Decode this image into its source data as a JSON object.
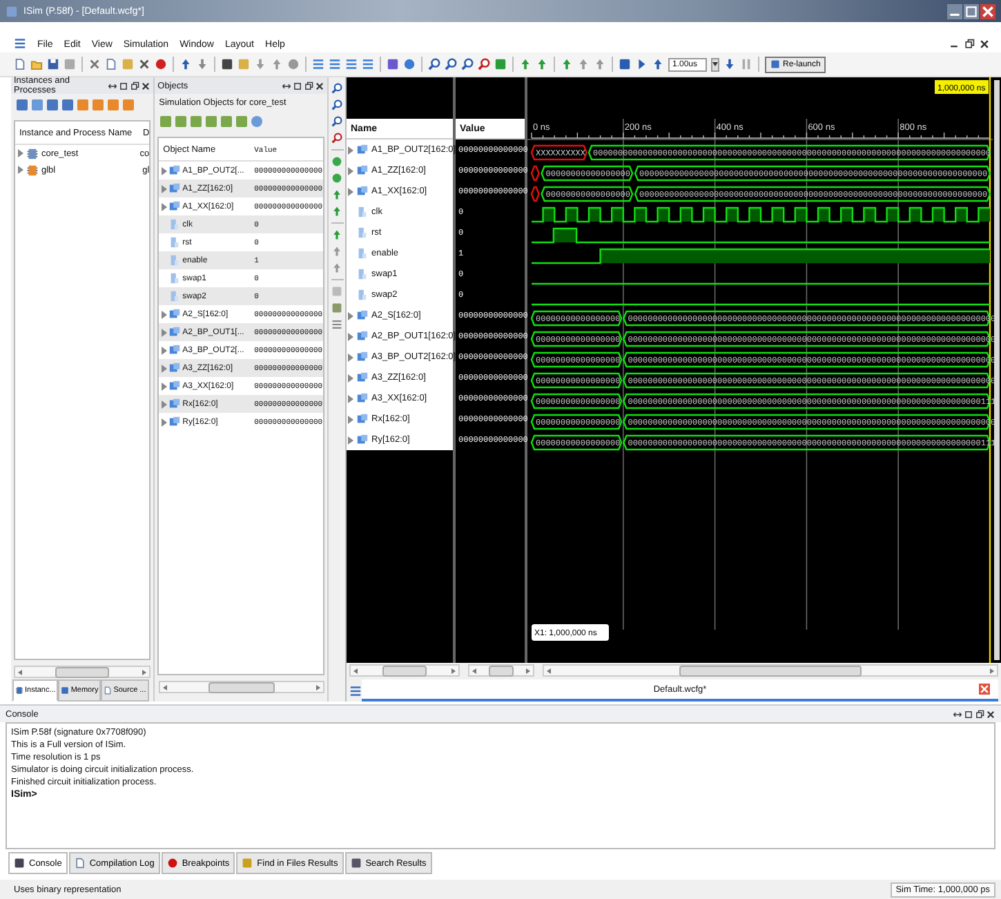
{
  "window": {
    "title": "ISim (P.58f) - [Default.wcfg*]"
  },
  "menu": [
    "File",
    "Edit",
    "View",
    "Simulation",
    "Window",
    "Layout",
    "Help"
  ],
  "toolbar": {
    "time_field": {
      "value": "1.00us"
    },
    "relaunch_button": "Re-launch"
  },
  "instances_panel": {
    "title": "Instances and Processes",
    "columns": [
      "Instance and Process Name",
      "D"
    ],
    "rows": [
      {
        "name": "core_test",
        "column_2": "co",
        "color": "#6d8fc2"
      },
      {
        "name": "glbl",
        "column_2": "gl",
        "color": "#e8892c"
      }
    ],
    "tabs": [
      {
        "label": "Instanc...",
        "selected": true
      },
      {
        "label": "Memory",
        "selected": false
      },
      {
        "label": "Source ...",
        "selected": false
      }
    ]
  },
  "objects_panel": {
    "title": "Objects",
    "subtitle": "Simulation Objects for core_test",
    "columns": [
      "Object Name",
      "Value"
    ],
    "rows": [
      {
        "name": "A1_BP_OUT2[...",
        "value": "000000000000000",
        "kind": "bus"
      },
      {
        "name": "A1_ZZ[162:0]",
        "value": "000000000000000",
        "kind": "bus"
      },
      {
        "name": "A1_XX[162:0]",
        "value": "000000000000000",
        "kind": "bus"
      },
      {
        "name": "clk",
        "value": "0",
        "kind": "bit"
      },
      {
        "name": "rst",
        "value": "0",
        "kind": "bit"
      },
      {
        "name": "enable",
        "value": "1",
        "kind": "bit"
      },
      {
        "name": "swap1",
        "value": "0",
        "kind": "bit"
      },
      {
        "name": "swap2",
        "value": "0",
        "kind": "bit"
      },
      {
        "name": "A2_S[162:0]",
        "value": "000000000000000",
        "kind": "bus"
      },
      {
        "name": "A2_BP_OUT1[...",
        "value": "000000000000000",
        "kind": "bus"
      },
      {
        "name": "A3_BP_OUT2[...",
        "value": "000000000000000",
        "kind": "bus"
      },
      {
        "name": "A3_ZZ[162:0]",
        "value": "000000000000000",
        "kind": "bus"
      },
      {
        "name": "A3_XX[162:0]",
        "value": "000000000000000",
        "kind": "bus"
      },
      {
        "name": "Rx[162:0]",
        "value": "000000000000000",
        "kind": "bus"
      },
      {
        "name": "Ry[162:0]",
        "value": "000000000000000",
        "kind": "bus"
      }
    ]
  },
  "wave_window": {
    "columns": [
      "Name",
      "Value"
    ],
    "time_marker": "1,000,000 ns",
    "time_labels": [
      "0 ns",
      "200 ns",
      "400 ns",
      "600 ns",
      "800 ns"
    ],
    "cursor_label": "X1: 1,000,000 ns",
    "tab": "Default.wcfg*",
    "signals": [
      {
        "name": "A1_BP_OUT2[162:0]",
        "value": "00000000000000",
        "kind": "bus",
        "segments": [
          {
            "label": "XXXXXXXXXX",
            "unknown": true
          },
          {
            "label": "00000000000000000000000000000000000000000000000000000000000000000000000000000000",
            "unknown": false
          }
        ]
      },
      {
        "name": "A1_ZZ[162:0]",
        "value": "00000000000000",
        "kind": "bus",
        "segments": [
          {
            "unknown": true
          },
          {
            "label": "00000000000000000",
            "unknown": false
          },
          {
            "label": "0000000000000000000000000000000000000000000000000000000000000000000000",
            "unknown": false
          }
        ]
      },
      {
        "name": "A1_XX[162:0]",
        "value": "00000000000000",
        "kind": "bus",
        "segments": [
          {
            "unknown": true
          },
          {
            "label": "00000000000000000",
            "unknown": false
          },
          {
            "label": "0000000000000000000000000000000000000000000000000000000000000000000000",
            "unknown": false
          }
        ]
      },
      {
        "name": "clk",
        "value": "0",
        "kind": "clock"
      },
      {
        "name": "rst",
        "value": "0",
        "kind": "pulse"
      },
      {
        "name": "enable",
        "value": "1",
        "kind": "step"
      },
      {
        "name": "swap1",
        "value": "0",
        "kind": "low"
      },
      {
        "name": "swap2",
        "value": "0",
        "kind": "low"
      },
      {
        "name": "A2_S[162:0]",
        "value": "00000000000000",
        "kind": "bus",
        "segments": [
          {
            "label": "00000000000000000",
            "unknown": false
          },
          {
            "label": "00000000000000000000000000000000000000000000000000000000000000000000000000",
            "unknown": false
          }
        ]
      },
      {
        "name": "A2_BP_OUT1[162:0]",
        "value": "00000000000000",
        "kind": "bus",
        "segments": [
          {
            "label": "00000000000000000",
            "unknown": false
          },
          {
            "label": "00000000000000000000000000000000000000000000000000000000000000000000000000",
            "unknown": false
          }
        ]
      },
      {
        "name": "A3_BP_OUT2[162:0]",
        "value": "00000000000000",
        "kind": "bus",
        "segments": [
          {
            "label": "00000000000000000",
            "unknown": false
          },
          {
            "label": "00000000000000000000000000000000000000000000000000000000000000000000000000",
            "unknown": false
          }
        ]
      },
      {
        "name": "A3_ZZ[162:0]",
        "value": "00000000000000",
        "kind": "bus",
        "segments": [
          {
            "label": "00000000000000000",
            "unknown": false
          },
          {
            "label": "00000000000000000000000000000000000000000000000000000000000000000000000000",
            "unknown": false
          }
        ]
      },
      {
        "name": "A3_XX[162:0]",
        "value": "00000000000000",
        "kind": "bus",
        "segments": [
          {
            "label": "00000000000000000",
            "unknown": false
          },
          {
            "label": "00000000000000000000000000000000000000000000000000000000000000000000000111",
            "unknown": false
          }
        ]
      },
      {
        "name": "Rx[162:0]",
        "value": "00000000000000",
        "kind": "bus",
        "segments": [
          {
            "label": "00000000000000000",
            "unknown": false
          },
          {
            "label": "00000000000000000000000000000000000000000000000000000000000000000000000000",
            "unknown": false
          }
        ]
      },
      {
        "name": "Ry[162:0]",
        "value": "00000000000000",
        "kind": "bus",
        "segments": [
          {
            "label": "00000000000000000",
            "unknown": false
          },
          {
            "label": "00000000000000000000000000000000000000000000000000000000000000000000000111",
            "unknown": false
          }
        ]
      }
    ]
  },
  "console": {
    "title": "Console",
    "lines": [
      "ISim P.58f (signature 0x7708f090)",
      "This is a Full version of ISim.",
      "Time resolution is 1 ps",
      "Simulator is doing circuit initialization process.",
      "Finished circuit initialization process."
    ],
    "prompt": "ISim>",
    "tabs": [
      {
        "label": "Console",
        "selected": true,
        "kind": "console"
      },
      {
        "label": "Compilation Log",
        "selected": false,
        "kind": "log"
      },
      {
        "label": "Breakpoints",
        "selected": false,
        "kind": "breakpoint"
      },
      {
        "label": "Find in Files Results",
        "selected": false,
        "kind": "find"
      },
      {
        "label": "Search Results",
        "selected": false,
        "kind": "search"
      }
    ]
  },
  "status_bar": {
    "message": "Uses binary representation",
    "sim_time": "Sim Time: 1,000,000 ps"
  }
}
